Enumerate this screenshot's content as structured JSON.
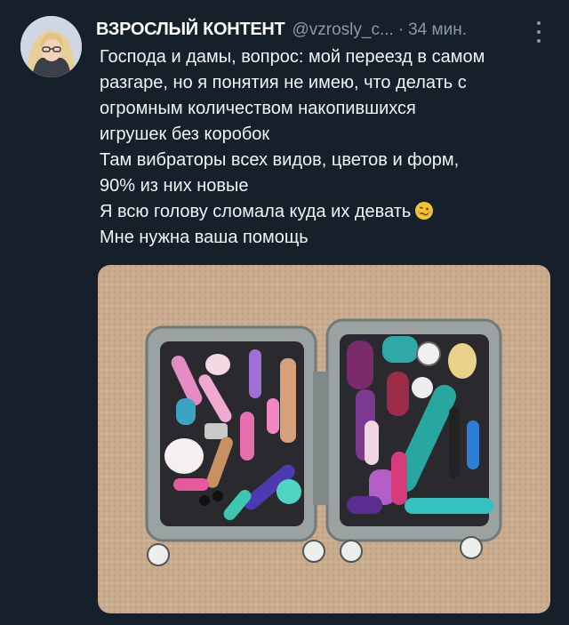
{
  "tweet": {
    "author": {
      "display_name": "ВЗРОСЛЫЙ КОНТЕНТ",
      "handle": "@vzrosly_c...",
      "avatar_icon": "user-avatar"
    },
    "separator": "·",
    "timestamp": "34 мин.",
    "more_icon": "more-vertical-icon",
    "text_lines": [
      "Господа и дамы, вопрос: мой переезд в самом",
      "разгаре, но я понятия не имею, что делать с",
      "огромным количеством накопившихся",
      "игрушек без коробок",
      "Там вибраторы всех видов, цветов и форм,",
      "90% из них новые",
      "Я всю голову сломала куда их девать",
      "Мне нужна ваша помощь"
    ],
    "emoji_icon": "woozy-face-emoji",
    "media": {
      "type": "photo",
      "icon": "photo-suitcase"
    }
  },
  "colors": {
    "background": "#15202b",
    "text": "#ffffff",
    "muted": "#8b98a5"
  }
}
